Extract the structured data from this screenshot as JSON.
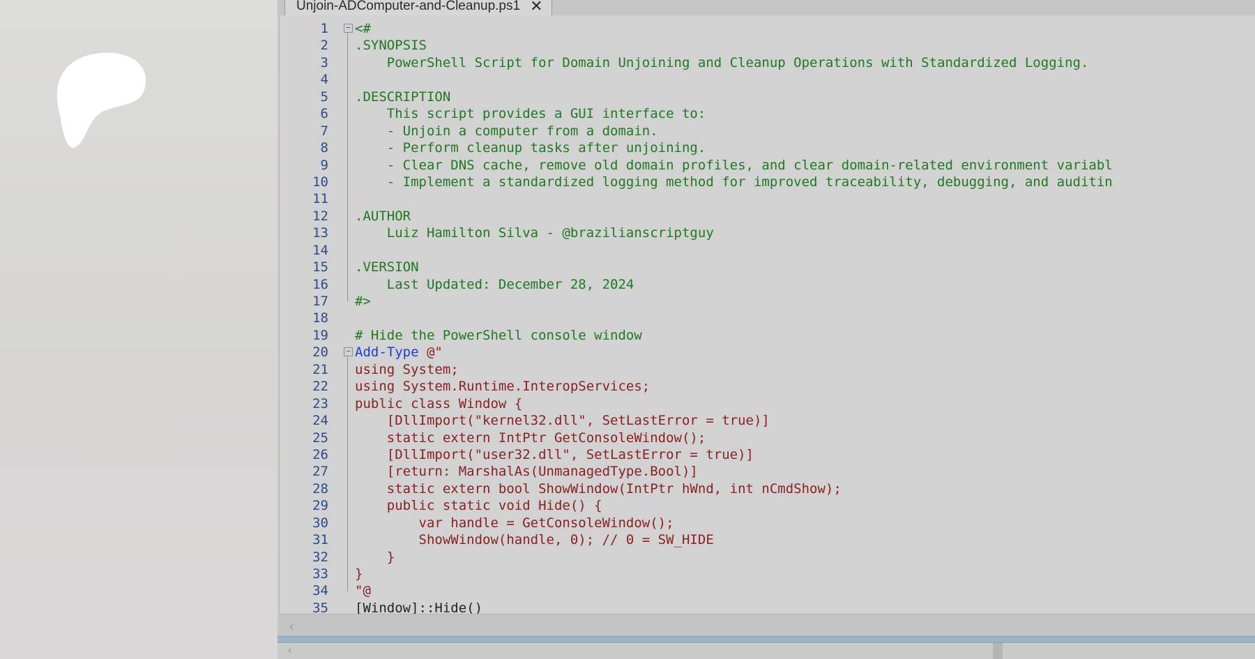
{
  "tab": {
    "title": "Unjoin-ADComputer-and-Cleanup.ps1",
    "close_glyph": "✕"
  },
  "editor": {
    "lines": [
      {
        "n": "1",
        "text": "<#",
        "kind": "comment",
        "fold": "⊟"
      },
      {
        "n": "2",
        "text": ".SYNOPSIS",
        "kind": "comment"
      },
      {
        "n": "3",
        "text": "    PowerShell Script for Domain Unjoining and Cleanup Operations with Standardized Logging.",
        "kind": "comment"
      },
      {
        "n": "4",
        "text": "",
        "kind": "comment"
      },
      {
        "n": "5",
        "text": ".DESCRIPTION",
        "kind": "comment"
      },
      {
        "n": "6",
        "text": "    This script provides a GUI interface to:",
        "kind": "comment"
      },
      {
        "n": "7",
        "text": "    - Unjoin a computer from a domain.",
        "kind": "comment"
      },
      {
        "n": "8",
        "text": "    - Perform cleanup tasks after unjoining.",
        "kind": "comment"
      },
      {
        "n": "9",
        "text": "    - Clear DNS cache, remove old domain profiles, and clear domain-related environment variabl",
        "kind": "comment"
      },
      {
        "n": "10",
        "text": "    - Implement a standardized logging method for improved traceability, debugging, and auditin",
        "kind": "comment"
      },
      {
        "n": "11",
        "text": "",
        "kind": "comment"
      },
      {
        "n": "12",
        "text": ".AUTHOR",
        "kind": "comment"
      },
      {
        "n": "13",
        "text": "    Luiz Hamilton Silva - @brazilianscriptguy",
        "kind": "comment"
      },
      {
        "n": "14",
        "text": "",
        "kind": "comment"
      },
      {
        "n": "15",
        "text": ".VERSION",
        "kind": "comment"
      },
      {
        "n": "16",
        "text": "    Last Updated: December 28, 2024",
        "kind": "comment"
      },
      {
        "n": "17",
        "text": "#>",
        "kind": "comment"
      },
      {
        "n": "18",
        "text": "",
        "kind": "default"
      },
      {
        "n": "19",
        "text": "# Hide the PowerShell console window",
        "kind": "comment"
      },
      {
        "n": "20",
        "text": "Add-Type",
        "suffix": " @\"",
        "kind": "cmdlet",
        "fold": "⊟"
      },
      {
        "n": "21",
        "text": "using System;",
        "kind": "string"
      },
      {
        "n": "22",
        "text": "using System.Runtime.InteropServices;",
        "kind": "string"
      },
      {
        "n": "23",
        "text": "public class Window {",
        "kind": "string"
      },
      {
        "n": "24",
        "text": "    [DllImport(\"kernel32.dll\", SetLastError = true)]",
        "kind": "string"
      },
      {
        "n": "25",
        "text": "    static extern IntPtr GetConsoleWindow();",
        "kind": "string"
      },
      {
        "n": "26",
        "text": "    [DllImport(\"user32.dll\", SetLastError = true)]",
        "kind": "string"
      },
      {
        "n": "27",
        "text": "    [return: MarshalAs(UnmanagedType.Bool)]",
        "kind": "string"
      },
      {
        "n": "28",
        "text": "    static extern bool ShowWindow(IntPtr hWnd, int nCmdShow);",
        "kind": "string"
      },
      {
        "n": "29",
        "text": "    public static void Hide() {",
        "kind": "string"
      },
      {
        "n": "30",
        "text": "        var handle = GetConsoleWindow();",
        "kind": "string"
      },
      {
        "n": "31",
        "text": "        ShowWindow(handle, 0); // 0 = SW_HIDE",
        "kind": "string"
      },
      {
        "n": "32",
        "text": "    }",
        "kind": "string"
      },
      {
        "n": "33",
        "text": "}",
        "kind": "string"
      },
      {
        "n": "34",
        "text": "\"@",
        "kind": "string"
      },
      {
        "n": "35",
        "text": "[Window]::Hide()",
        "kind": "default"
      }
    ]
  },
  "scrollbar": {
    "left_arrow": "‹"
  },
  "console": {
    "scroll_glyph": "‹"
  },
  "colors": {
    "comment": "#1e7a1e",
    "cmdlet": "#1a3fd0",
    "string": "#8b1f1f",
    "line_number": "#2a4c8a",
    "splitter": "#9eb3c6"
  }
}
